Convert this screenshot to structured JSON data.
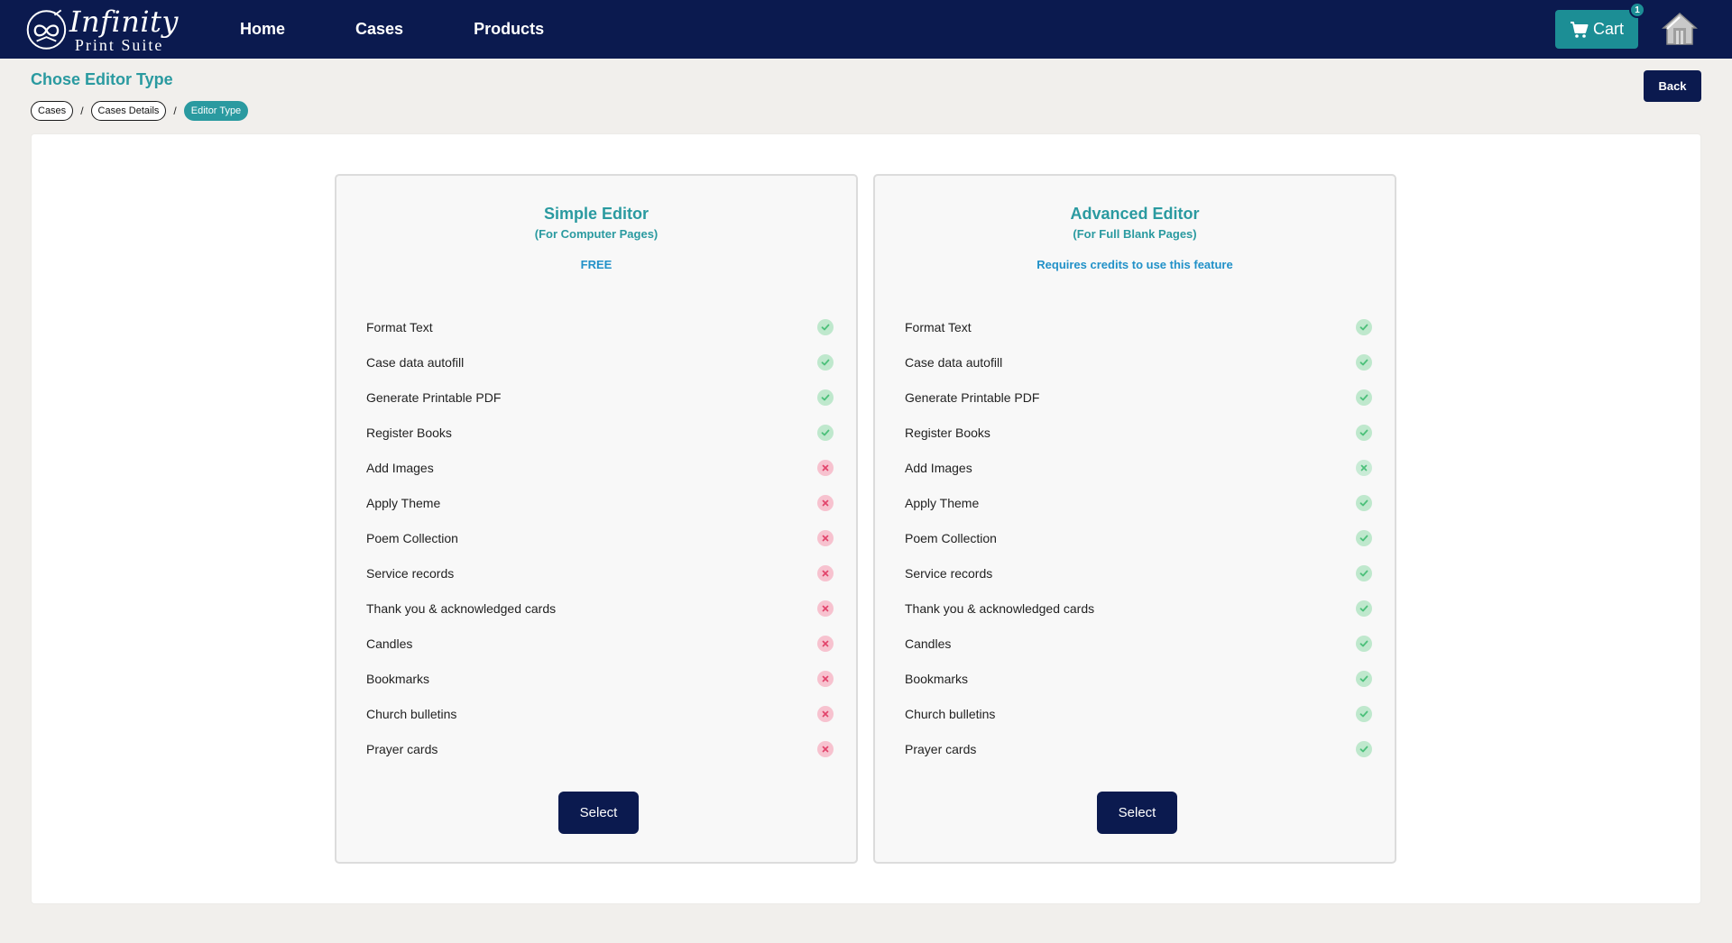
{
  "brand": {
    "title": "Infinity",
    "subtitle": "Print Suite"
  },
  "nav": {
    "home": "Home",
    "cases": "Cases",
    "products": "Products"
  },
  "cart": {
    "label": "Cart",
    "count": "1"
  },
  "page": {
    "title": "Chose Editor Type",
    "back_label": "Back",
    "breadcrumb": [
      "Cases",
      "Cases Details",
      "Editor Type"
    ],
    "separator": "/"
  },
  "colors": {
    "navy": "#0b1a4f",
    "teal": "#2a9aa0",
    "included": "#4cc07a",
    "excluded": "#e2446b"
  },
  "editors": [
    {
      "title": "Simple Editor",
      "subtitle": "(For Computer Pages)",
      "price": "FREE",
      "select_label": "Select",
      "features": [
        {
          "label": "Format Text",
          "included": true
        },
        {
          "label": "Case data autofill",
          "included": true
        },
        {
          "label": "Generate Printable PDF",
          "included": true
        },
        {
          "label": "Register Books",
          "included": true
        },
        {
          "label": "Add Images",
          "included": false
        },
        {
          "label": "Apply Theme",
          "included": false
        },
        {
          "label": "Poem Collection",
          "included": false
        },
        {
          "label": "Service records",
          "included": false
        },
        {
          "label": "Thank you & acknowledged cards",
          "included": false
        },
        {
          "label": "Candles",
          "included": false
        },
        {
          "label": "Bookmarks",
          "included": false
        },
        {
          "label": "Church bulletins",
          "included": false
        },
        {
          "label": "Prayer cards",
          "included": false
        }
      ]
    },
    {
      "title": "Advanced Editor",
      "subtitle": "(For Full Blank Pages)",
      "price": "Requires credits to use this feature",
      "select_label": "Select",
      "features": [
        {
          "label": "Format Text",
          "included": true
        },
        {
          "label": "Case data autofill",
          "included": true
        },
        {
          "label": "Generate Printable PDF",
          "included": true
        },
        {
          "label": "Register Books",
          "included": true
        },
        {
          "label": "Add Images",
          "included": false,
          "icon_color": "green"
        },
        {
          "label": "Apply Theme",
          "included": true
        },
        {
          "label": "Poem Collection",
          "included": true
        },
        {
          "label": "Service records",
          "included": true
        },
        {
          "label": "Thank you & acknowledged cards",
          "included": true
        },
        {
          "label": "Candles",
          "included": true
        },
        {
          "label": "Bookmarks",
          "included": true
        },
        {
          "label": "Church bulletins",
          "included": true
        },
        {
          "label": "Prayer cards",
          "included": true
        }
      ]
    }
  ]
}
